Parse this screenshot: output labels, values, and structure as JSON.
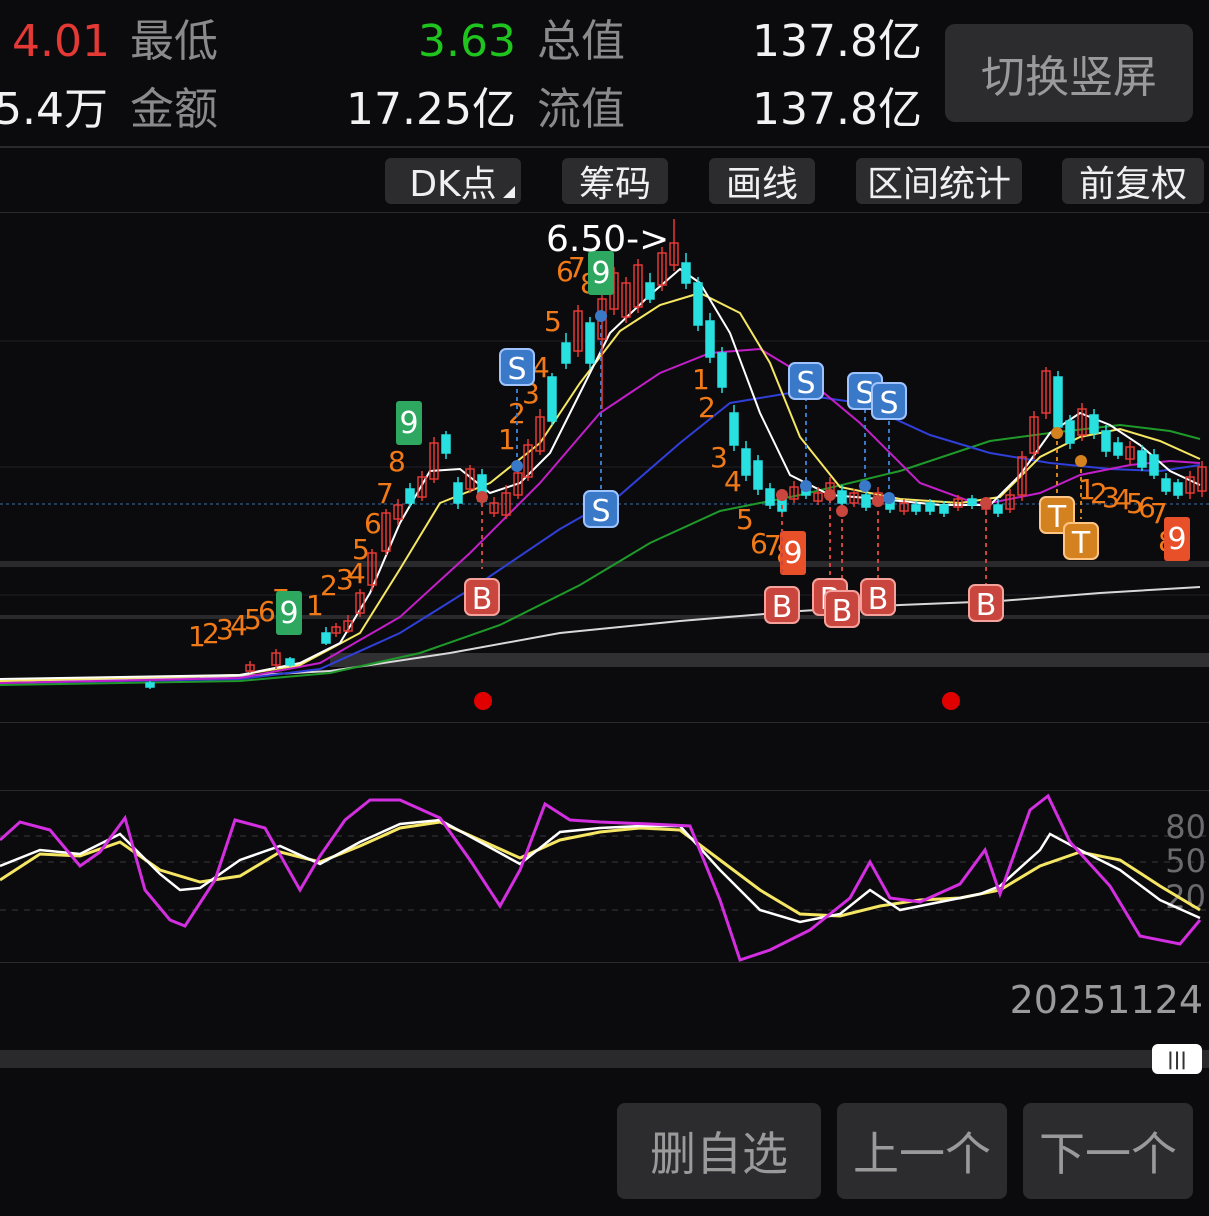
{
  "quote": {
    "high_value": "4.01",
    "low_label": "最低",
    "low_value": "3.63",
    "total_cap_label": "总值",
    "total_cap_value": "137.8亿",
    "volume_value": "5.4万",
    "amount_label": "金额",
    "amount_value": "17.25亿",
    "float_cap_label": "流值",
    "float_cap_value": "137.8亿"
  },
  "switch_button": "切换竖屏",
  "toolbar": {
    "dk_label": "DK点",
    "chips_label": "筹码",
    "draw_label": "画线",
    "range_stats_label": "区间统计",
    "adjust_label": "前复权"
  },
  "chart": {
    "high_annotation": "6.50->",
    "kdj_levels": [
      "80",
      "50",
      "20"
    ],
    "date_label": "20251124",
    "colors": {
      "up": "#e53935",
      "down": "#28e0e0",
      "ma_white": "#ffffff",
      "ma_yellow": "#f5e663",
      "ma_magenta": "#c21fc9",
      "ma_blue": "#2f3fd8",
      "ma_green": "#1f9a2a",
      "ma_gray": "#d8d8d8",
      "td_orange": "#f07a18",
      "badge_green": "#2ea860",
      "badge_sell": "#3a78c8",
      "badge_buy": "#c9463f",
      "badge_t": "#d4821f"
    },
    "markers": {
      "buy": "B",
      "sell": "S",
      "t": "T",
      "nine": "9"
    }
  },
  "scroll_icon": "|||",
  "bottom": {
    "delete_label": "删自选",
    "prev_label": "上一个",
    "next_label": "下一个"
  }
}
